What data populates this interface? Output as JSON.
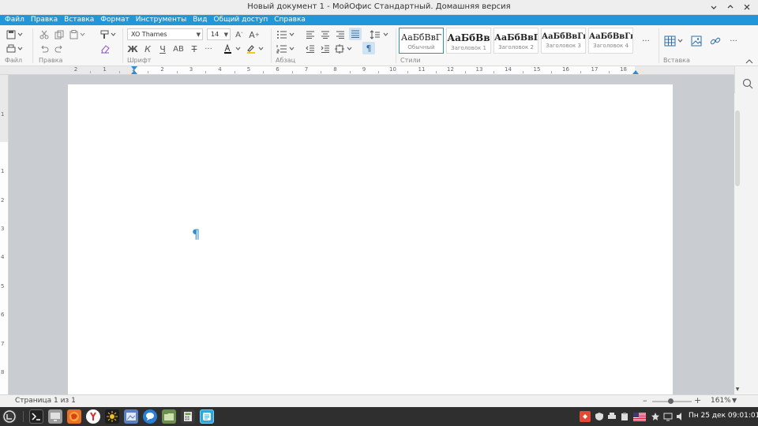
{
  "window": {
    "title": "Новый документ 1 - МойОфис Стандартный. Домашняя версия"
  },
  "menu": [
    "Файл",
    "Правка",
    "Вставка",
    "Формат",
    "Инструменты",
    "Вид",
    "Общий доступ",
    "Справка"
  ],
  "ribbon": {
    "groups": {
      "file": "Файл",
      "edit": "Правка",
      "font": "Шрифт",
      "paragraph": "Абзац",
      "styles": "Стили",
      "insert": "Вставка"
    },
    "font_name": "XO Thames",
    "font_size": "14",
    "format_buttons": {
      "bold": "Ж",
      "italic": "К",
      "underline": "Ч",
      "case": "АВ",
      "strike": "Т"
    },
    "font_grow": "A",
    "font_shrink": "A",
    "more": "···",
    "styles": [
      {
        "sample": "АаБбВвГ",
        "name": "Обычный"
      },
      {
        "sample": "АаБбВв",
        "name": "Заголовок 1"
      },
      {
        "sample": "АаБбВвГ",
        "name": "Заголовок 2"
      },
      {
        "sample": "АаБбВвГг",
        "name": "Заголовок 3"
      },
      {
        "sample": "АаБбВвГг",
        "name": "Заголовок 4"
      }
    ]
  },
  "ruler": {
    "h_labels": [
      "2",
      "1",
      "1",
      "2",
      "3",
      "4",
      "5",
      "6",
      "7",
      "8",
      "9",
      "10",
      "11",
      "12",
      "13",
      "14",
      "15",
      "16",
      "17",
      "18"
    ],
    "v_labels": [
      "1",
      "1",
      "2",
      "3",
      "4",
      "5",
      "6",
      "7",
      "8"
    ]
  },
  "document": {
    "pilcrow": "¶"
  },
  "status": {
    "page_info": "Страница 1 из 1",
    "zoom": "161%",
    "zoom_minus": "–",
    "zoom_plus": "+"
  },
  "taskbar": {
    "clock": "Пн 25 дек  09:01:01"
  }
}
